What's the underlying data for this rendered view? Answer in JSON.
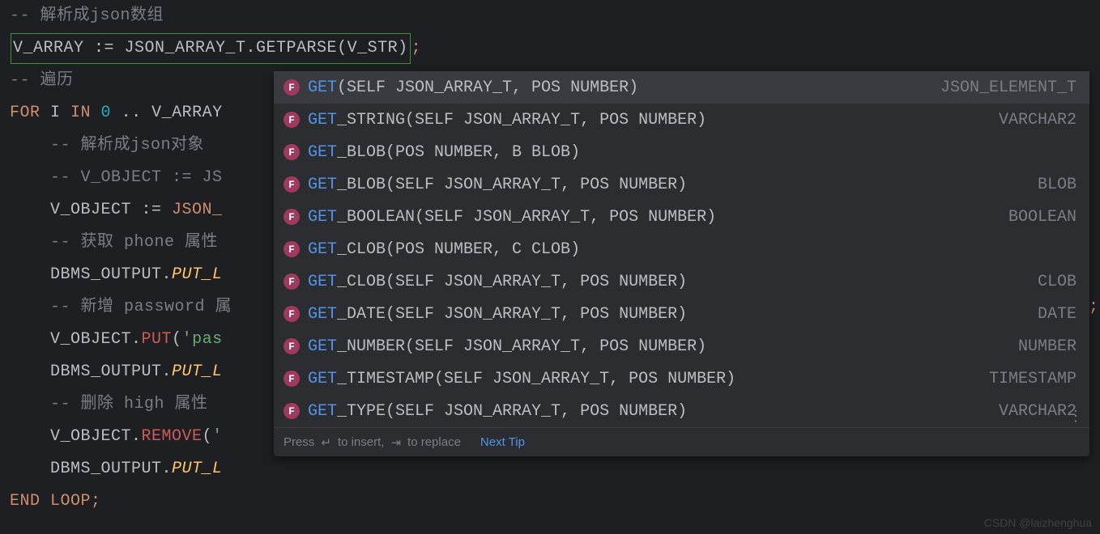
{
  "code": {
    "c1": "-- 解析成json数组",
    "l2_box": "V_ARRAY := JSON_ARRAY_T.GETPARSE(V_STR)",
    "l2_semi": ";",
    "c3": "-- 遍历",
    "l4_for": "FOR",
    "l4_i": " I ",
    "l4_in": "IN",
    "l4_zero": " 0 ",
    "l4_dots": "..",
    "l4_arr": " V_ARRAY",
    "c5": "    -- 解析成json对象",
    "l6": "    -- V_OBJECT := JS",
    "l7_a": "    V_OBJECT ",
    "l7_assign": ":= ",
    "l7_json": "JSON_",
    "c8": "    -- 获取 phone 属性",
    "l9_a": "    DBMS_OUTPUT.",
    "l9_put": "PUT_L",
    "c10": "    -- 新增 password 属",
    "l11_a": "    V_OBJECT.",
    "l11_put": "PUT",
    "l11_open": "(",
    "l11_str": "'pas",
    "l12_a": "    DBMS_OUTPUT.",
    "l12_put": "PUT_L",
    "c13": "    -- 删除 high 属性",
    "l14_a": "    V_OBJECT.",
    "l14_rem": "REMOVE",
    "l14_open": "(",
    "l14_str": "'",
    "l15_a": "    DBMS_OUTPUT.",
    "l15_put": "PUT_L",
    "l16_end": "END",
    "l16_loop": " LOOP",
    "l16_semi": ";"
  },
  "suggestions": [
    {
      "match": "GET",
      "rest": "(SELF JSON_ARRAY_T, POS NUMBER)",
      "ret": "JSON_ELEMENT_T",
      "selected": true
    },
    {
      "match": "GET",
      "rest": "_STRING(SELF JSON_ARRAY_T, POS NUMBER)",
      "ret": "VARCHAR2"
    },
    {
      "match": "GET",
      "rest": "_BLOB(POS NUMBER, B BLOB)",
      "ret": ""
    },
    {
      "match": "GET",
      "rest": "_BLOB(SELF JSON_ARRAY_T, POS NUMBER)",
      "ret": "BLOB"
    },
    {
      "match": "GET",
      "rest": "_BOOLEAN(SELF JSON_ARRAY_T, POS NUMBER)",
      "ret": "BOOLEAN"
    },
    {
      "match": "GET",
      "rest": "_CLOB(POS NUMBER, C CLOB)",
      "ret": ""
    },
    {
      "match": "GET",
      "rest": "_CLOB(SELF JSON_ARRAY_T, POS NUMBER)",
      "ret": "CLOB"
    },
    {
      "match": "GET",
      "rest": "_DATE(SELF JSON_ARRAY_T, POS NUMBER)",
      "ret": "DATE"
    },
    {
      "match": "GET",
      "rest": "_NUMBER(SELF JSON_ARRAY_T, POS NUMBER)",
      "ret": "NUMBER"
    },
    {
      "match": "GET",
      "rest": "_TIMESTAMP(SELF JSON_ARRAY_T, POS NUMBER)",
      "ret": "TIMESTAMP"
    },
    {
      "match": "GET",
      "rest": "_TYPE(SELF JSON_ARRAY_T, POS NUMBER)",
      "ret": "VARCHAR2"
    }
  ],
  "footer": {
    "hint1": "Press ",
    "k1": "↵",
    "hint2": " to insert, ",
    "k2": "⇥",
    "hint3": " to replace",
    "next": "Next Tip"
  },
  "icon_label": "F",
  "watermark": "CSDN @laizhenghua"
}
